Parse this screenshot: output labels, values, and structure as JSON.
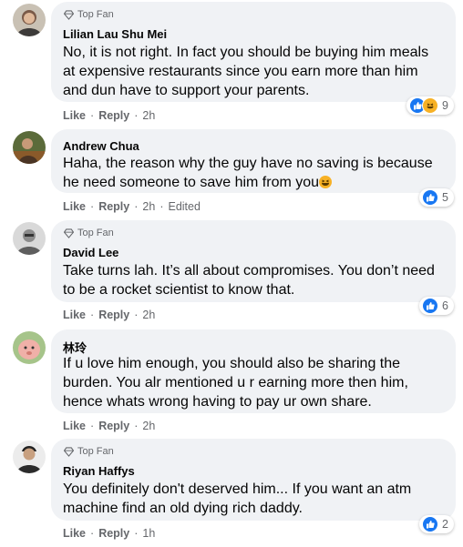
{
  "comments": [
    {
      "badge": "Top Fan",
      "name": "Lilian Lau Shu Mei",
      "lines": [
        "No, it is not right. In fact you should be buying him meals",
        "at expensive restaurants since you earn more than him",
        "and dun have to support your parents."
      ],
      "like": "Like",
      "reply": "Reply",
      "time": "2h",
      "edited": "",
      "reaction_count": "9",
      "reactions": [
        "like-icon",
        "haha-icon"
      ]
    },
    {
      "badge": "",
      "name": "Andrew Chua",
      "lines": [
        "Haha, the reason why the guy have no saving is because",
        "he need someone to save him from you"
      ],
      "trailing_emoji": "haha-emoji",
      "like": "Like",
      "reply": "Reply",
      "time": "2h",
      "edited": "Edited",
      "reaction_count": "5",
      "reactions": [
        "like-icon"
      ]
    },
    {
      "badge": "Top Fan",
      "name": "David Lee",
      "lines": [
        "Take turns lah. It’s all about compromises. You don’t need",
        "to be a rocket scientist to know that."
      ],
      "like": "Like",
      "reply": "Reply",
      "time": "2h",
      "edited": "",
      "reaction_count": "6",
      "reactions": [
        "like-icon"
      ]
    },
    {
      "badge": "",
      "name": "林玲",
      "lines": [
        "If u love him enough, you should also be sharing the",
        "burden. You alr mentioned u r earning more then him,",
        "hence whats wrong having to pay ur own share."
      ],
      "like": "Like",
      "reply": "Reply",
      "time": "2h",
      "edited": "",
      "reaction_count": "",
      "reactions": []
    },
    {
      "badge": "Top Fan",
      "name": "Riyan Haffys",
      "lines": [
        "You definitely don't deserved him... If you want an atm",
        "machine find an old dying rich daddy."
      ],
      "like": "Like",
      "reply": "Reply",
      "time": "1h",
      "edited": "",
      "reaction_count": "2",
      "reactions": [
        "like-icon"
      ]
    }
  ],
  "colors": {
    "bubble": "#f0f2f5",
    "secondary_text": "#65676b",
    "like_blue": "#1877f2",
    "haha_yellow": "#f7b125"
  }
}
